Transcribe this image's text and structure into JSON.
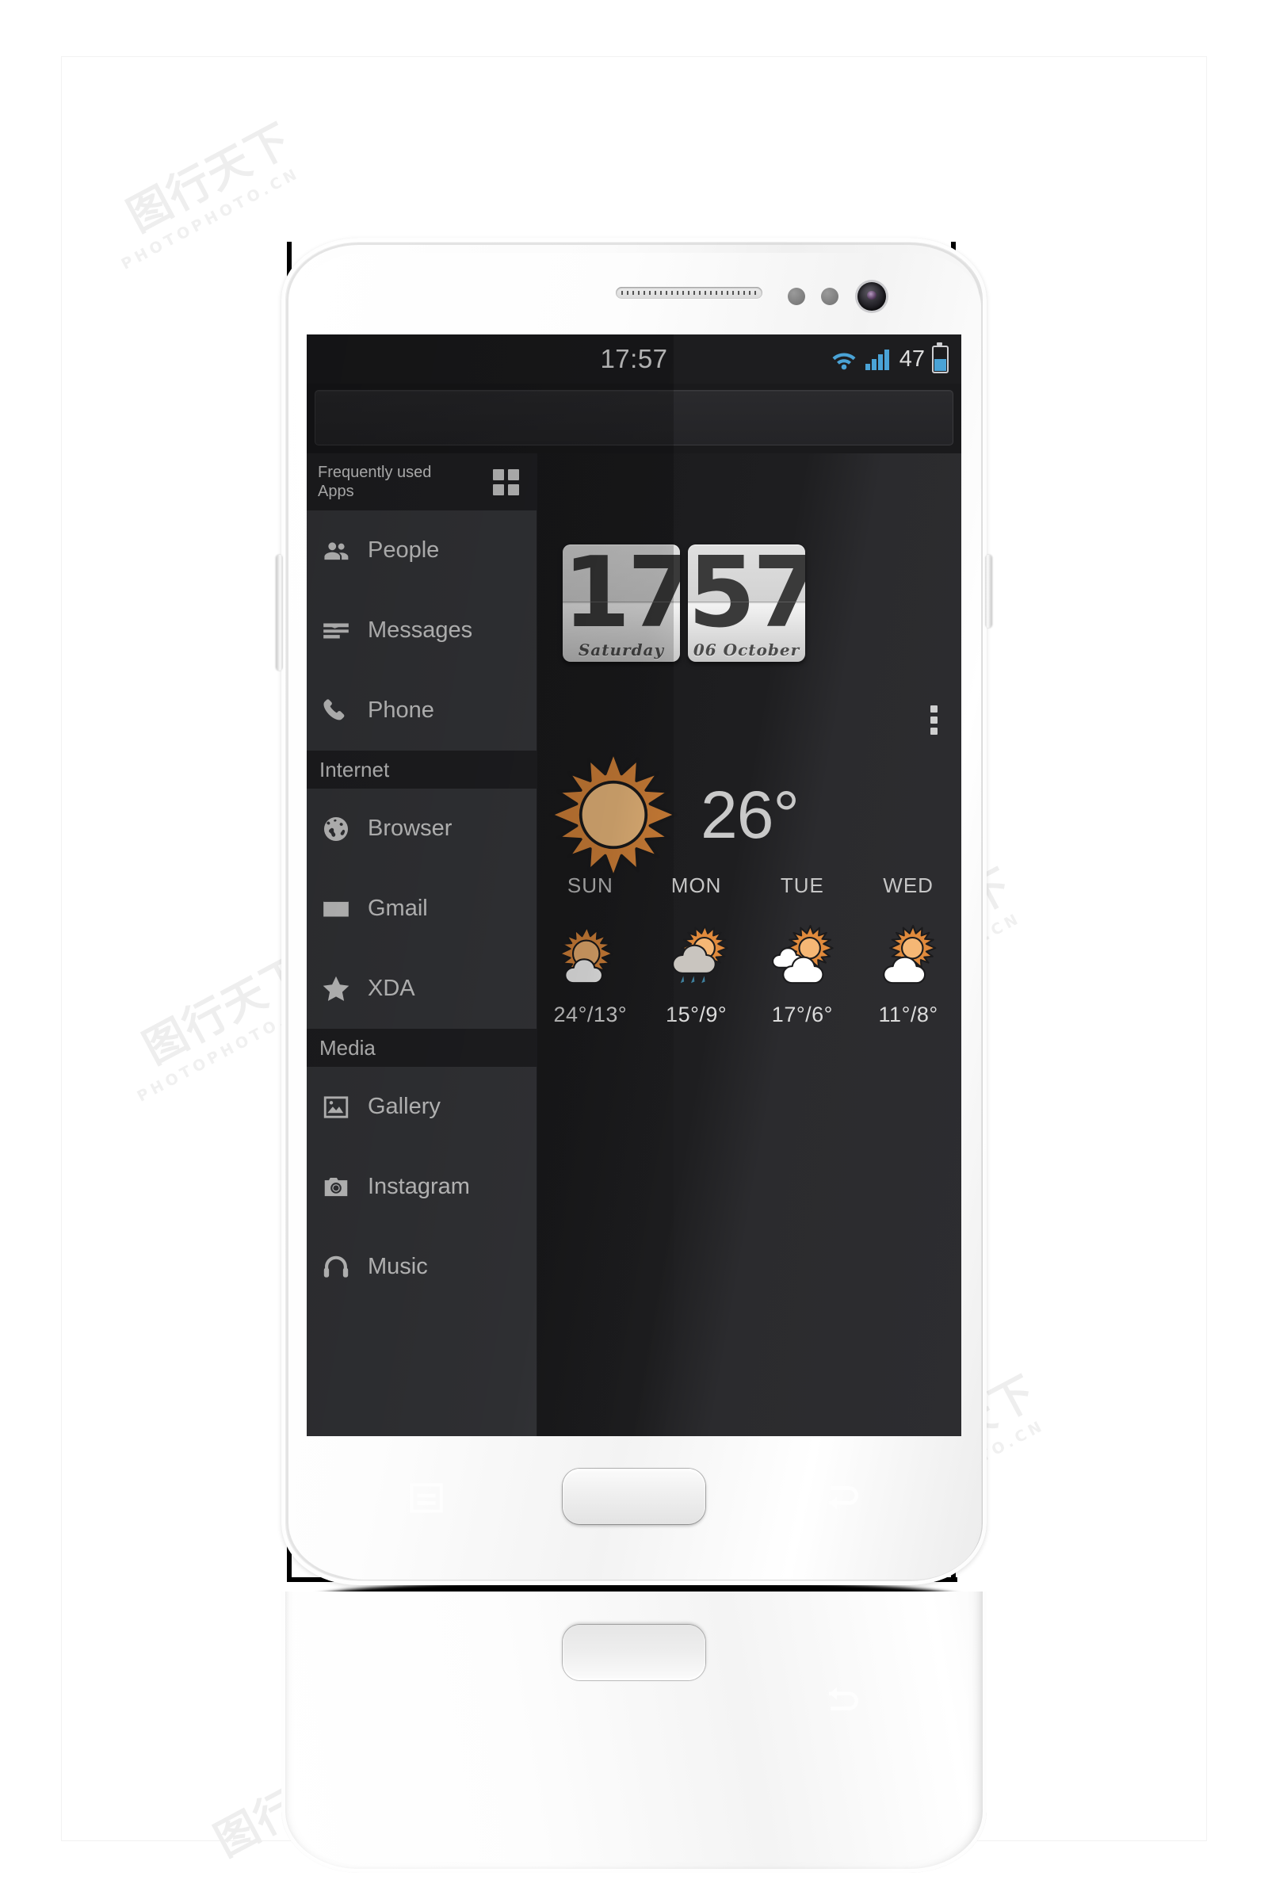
{
  "statusbar": {
    "time": "17:57",
    "battery_percent": "47",
    "icons": [
      "wifi-icon",
      "signal-icon",
      "battery-icon"
    ],
    "accent_blue": "#4aa3d6"
  },
  "sidebar": {
    "header": {
      "title": "Frequently used Apps",
      "icon": "grid-apps-icon"
    },
    "groups": [
      {
        "section": null,
        "items": [
          {
            "label": "People",
            "icon": "people-icon"
          },
          {
            "label": "Messages",
            "icon": "messages-icon"
          },
          {
            "label": "Phone",
            "icon": "phone-icon"
          }
        ]
      },
      {
        "section": "Internet",
        "items": [
          {
            "label": "Browser",
            "icon": "globe-icon"
          },
          {
            "label": "Gmail",
            "icon": "envelope-icon"
          },
          {
            "label": "XDA",
            "icon": "star-icon"
          }
        ]
      },
      {
        "section": "Media",
        "items": [
          {
            "label": "Gallery",
            "icon": "image-icon"
          },
          {
            "label": "Instagram",
            "icon": "camera-icon"
          },
          {
            "label": "Music",
            "icon": "headphones-icon"
          }
        ]
      }
    ]
  },
  "clock_widget": {
    "hours": "17",
    "minutes": "57",
    "hours_caption": "Saturday",
    "minutes_caption": "06  October"
  },
  "weather": {
    "overflow_icon": "more-vertical-icon",
    "current": {
      "temperature": "26°",
      "condition_icon": "sun-icon"
    },
    "sun_color": "#e08a3c",
    "sun_core_color": "#fac483",
    "forecast": [
      {
        "day": "SUN",
        "icon": "sun-cloud-icon",
        "temps": "24°/13°"
      },
      {
        "day": "MON",
        "icon": "rain-cloud-icon",
        "temps": "15°/9°"
      },
      {
        "day": "TUE",
        "icon": "sun-clouds-icon",
        "temps": "17°/6°"
      },
      {
        "day": "WED",
        "icon": "sun-cloud-icon",
        "temps": "11°/8°"
      }
    ]
  },
  "hardware": {
    "menu_key": "menu-key-icon",
    "home_button": "home-button",
    "back_key": "back-key-icon",
    "earpiece": "earpiece-speaker",
    "front_camera": "front-camera",
    "volume_button": "volume-rocker",
    "power_button": "power-button"
  },
  "watermarks": {
    "brand": "图行天下",
    "latin": "PHOTOPHOTO.CN"
  }
}
